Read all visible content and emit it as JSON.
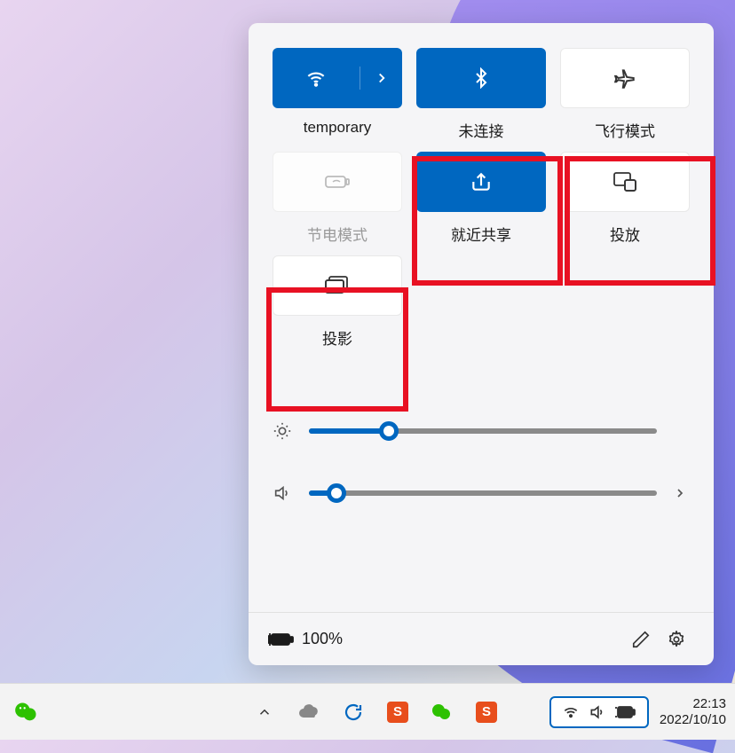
{
  "panel": {
    "tiles": [
      {
        "id": "wifi",
        "label": "temporary",
        "state": "active",
        "split": true
      },
      {
        "id": "bluetooth",
        "label": "未连接",
        "state": "active"
      },
      {
        "id": "airplane",
        "label": "飞行模式",
        "state": "inactive"
      },
      {
        "id": "battery-saver",
        "label": "节电模式",
        "state": "disabled"
      },
      {
        "id": "nearby-share",
        "label": "就近共享",
        "state": "active"
      },
      {
        "id": "cast",
        "label": "投放",
        "state": "inactive"
      },
      {
        "id": "project",
        "label": "投影",
        "state": "inactive"
      }
    ],
    "brightness_percent": 23,
    "volume_percent": 8,
    "battery_text": "100%"
  },
  "taskbar": {
    "time": "22:13",
    "date": "2022/10/10"
  },
  "icons": {
    "wifi": "wifi-icon",
    "chevron_right": "chevron-right-icon",
    "bluetooth": "bluetooth-icon",
    "airplane": "airplane-icon",
    "battery_saver": "battery-saver-icon",
    "share": "share-icon",
    "cast": "cast-icon",
    "project": "project-icon",
    "brightness": "brightness-icon",
    "volume": "volume-icon",
    "battery_plug": "battery-plug-icon",
    "pencil": "pencil-icon",
    "gear": "gear-icon",
    "chevron_up": "chevron-up-icon",
    "cloud": "cloud-icon",
    "sync": "sync-icon"
  }
}
